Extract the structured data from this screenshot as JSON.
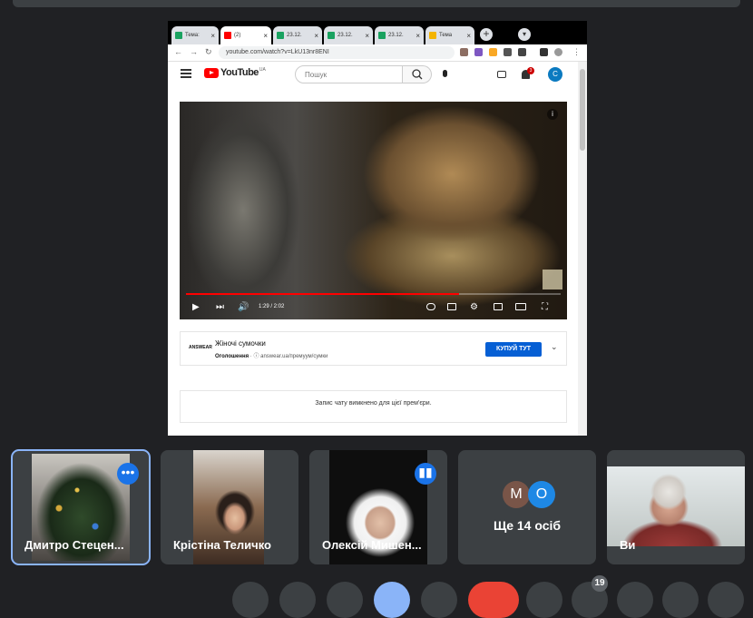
{
  "browser": {
    "tabs": [
      {
        "label": "Тема:",
        "color": "#1aa260",
        "active": false
      },
      {
        "label": "(2)",
        "color": "#ff0000",
        "active": true
      },
      {
        "label": "23.12.",
        "color": "#1aa260",
        "active": false
      },
      {
        "label": "23.12.",
        "color": "#1aa260",
        "active": false
      },
      {
        "label": "23.12.",
        "color": "#1aa260",
        "active": false
      },
      {
        "label": "Тема",
        "color": "#f4b400",
        "active": false
      }
    ],
    "new_tab": "+",
    "url": "youtube.com/watch?v=LkU13nr8ENI"
  },
  "youtube": {
    "logo": "YouTube",
    "region": "UA",
    "search_placeholder": "Пошук",
    "notifications": "3",
    "avatar_letter": "C",
    "video": {
      "time": "1:29 / 2:02",
      "progress": 0.73,
      "info": "i"
    },
    "ad": {
      "logo": "ANSWEAR",
      "title": "Жіночі сумочки",
      "label": "Оголошення",
      "url": "answear.ua/премуум/сумки",
      "cta": "КУПУЙ ТУТ"
    },
    "chat_notice": "Запис чату вимкнено для цієї прем'єри."
  },
  "participants": [
    {
      "name": "Дмитро Стецен...",
      "selected": true
    },
    {
      "name": "Крістіна Теличко"
    },
    {
      "name": "Олексій Мишен..."
    },
    {
      "more_label": "Ще 14 осіб",
      "avatars": [
        {
          "letter": "М",
          "color": "#795548"
        },
        {
          "letter": "О",
          "color": "#1e88e5"
        }
      ]
    },
    {
      "name": "Ви"
    }
  ],
  "controls": {
    "participant_count": "19"
  }
}
